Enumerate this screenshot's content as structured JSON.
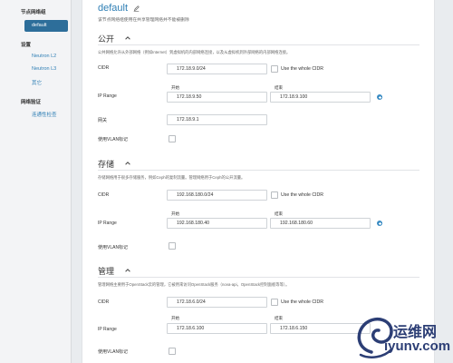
{
  "sidebar": {
    "group1": "节点网络组",
    "active_item": "default",
    "group2": "设置",
    "items": [
      "Neutron L2",
      "Neutron L3",
      "其它"
    ],
    "group3": "网络验证",
    "verify_item": "连通性检查"
  },
  "header": {
    "title": "default",
    "subtitle": "该节点网络组使用在共享管理网络并不能被删除"
  },
  "sections": [
    {
      "title": "公开",
      "desc": "公共网络允许从外部网络（例如Internet）到虚拟机的内部网络连接，以及从虚拟机到外部网络的内部网络连接。",
      "cidr_label": "CIDR",
      "cidr_value": "172.18.9.0/24",
      "use_whole_label": "Use the whole CIDR",
      "ip_range_label": "IP Range",
      "start_label": "开始",
      "end_label": "结束",
      "start_value": "172.18.9.50",
      "end_value": "172.18.9.100",
      "gateway_label": "网关",
      "gateway_value": "172.18.9.1",
      "vlan_label": "使用VLAN标记"
    },
    {
      "title": "存储",
      "desc": "存储网络用于很多存储服务，例如Ceph的复制流量。管理网络用于Ceph的公开流量。",
      "cidr_label": "CIDR",
      "cidr_value": "192.168.180.0/24",
      "use_whole_label": "Use the whole CIDR",
      "ip_range_label": "IP Range",
      "start_label": "开始",
      "end_label": "结束",
      "start_value": "192.168.180.40",
      "end_value": "192.168.180.60",
      "vlan_label": "使用VLAN标记"
    },
    {
      "title": "管理",
      "desc": "管理网络主要用于OpenStack云的管理，它被用来访问OpenStack服务（nova-api，OpenStack控制面板等等）。",
      "cidr_label": "CIDR",
      "cidr_value": "172.18.6.0/24",
      "use_whole_label": "Use the whole CIDR",
      "ip_range_label": "IP Range",
      "start_label": "开始",
      "end_label": "结束",
      "start_value": "172.18.6.100",
      "end_value": "172.18.6.150",
      "vlan_label": "使用VLAN标记"
    }
  ],
  "watermark": {
    "text_cn": "运维网",
    "url": "iyunv.com"
  },
  "icons": {
    "edit": "pencil-icon",
    "collapse": "chevron-up-icon",
    "add": "plus-circle-icon",
    "logo": "swirl-logo-icon"
  },
  "colors": {
    "accent": "#2f7fb5",
    "sidebar_active": "#2d6e9a",
    "watermark": "#2c3e75"
  }
}
